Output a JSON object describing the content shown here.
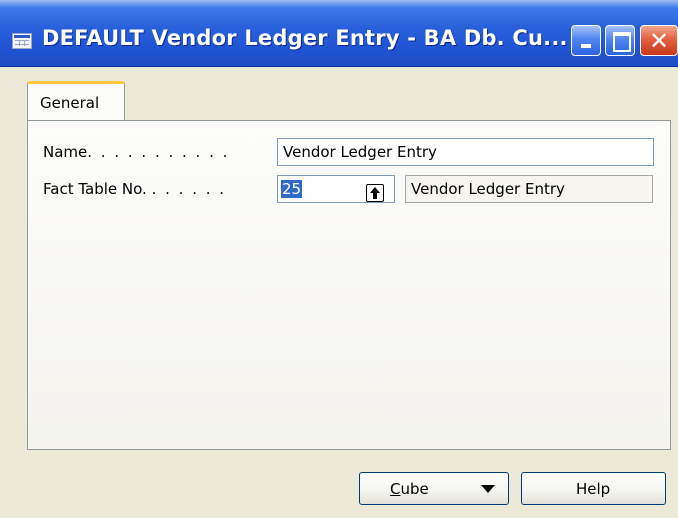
{
  "window": {
    "title": "DEFAULT Vendor Ledger Entry - BA Db. Cu...",
    "close_glyph": "✕"
  },
  "tabs": [
    {
      "label": "General",
      "selected": true
    }
  ],
  "form": {
    "name": {
      "label": "Name",
      "label_dots": ". . . . . . . . . . .",
      "value": "Vendor Ledger Entry"
    },
    "fact_table_no": {
      "label": "Fact Table No.",
      "label_dots": ". . . . . .",
      "value": "25",
      "lookup_icon": "up-arrow-icon",
      "description": "Vendor Ledger Entry"
    }
  },
  "buttons": {
    "cube": {
      "label_underlined": "C",
      "label_rest": "ube",
      "has_dropdown": true
    },
    "help": {
      "label": "Help"
    }
  },
  "colors": {
    "titlebar": "#2961dc",
    "tab_accent": "#ffc83c",
    "selection": "#316ac5",
    "close_button": "#c7391a"
  }
}
